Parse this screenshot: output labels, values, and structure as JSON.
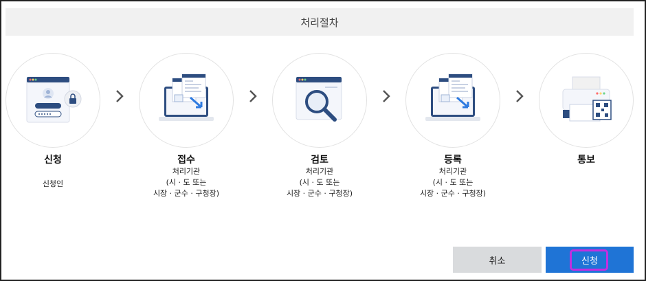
{
  "header": {
    "title": "처리절차"
  },
  "steps": [
    {
      "title": "신청",
      "desc": [
        "신청인"
      ],
      "icon": "login-form-lock-icon"
    },
    {
      "title": "접수",
      "desc": [
        "처리기관",
        "(시 · 도 또는",
        "시장 · 군수 · 구청장)"
      ],
      "icon": "laptop-documents-icon"
    },
    {
      "title": "검토",
      "desc": [
        "처리기관",
        "(시 · 도 또는",
        "시장 · 군수 · 구청장)"
      ],
      "icon": "magnifier-window-icon"
    },
    {
      "title": "등록",
      "desc": [
        "처리기관",
        "(시 · 도 또는",
        "시장 · 군수 · 구청장)"
      ],
      "icon": "laptop-documents-icon"
    },
    {
      "title": "통보",
      "desc": [],
      "icon": "printer-qr-icon"
    }
  ],
  "buttons": {
    "cancel": "취소",
    "submit": "신청"
  },
  "colors": {
    "primary": "#1f74d6",
    "cancel_bg": "#d9dbdd",
    "highlight": "#c42ee0",
    "header_bg": "#f1f1f1"
  }
}
